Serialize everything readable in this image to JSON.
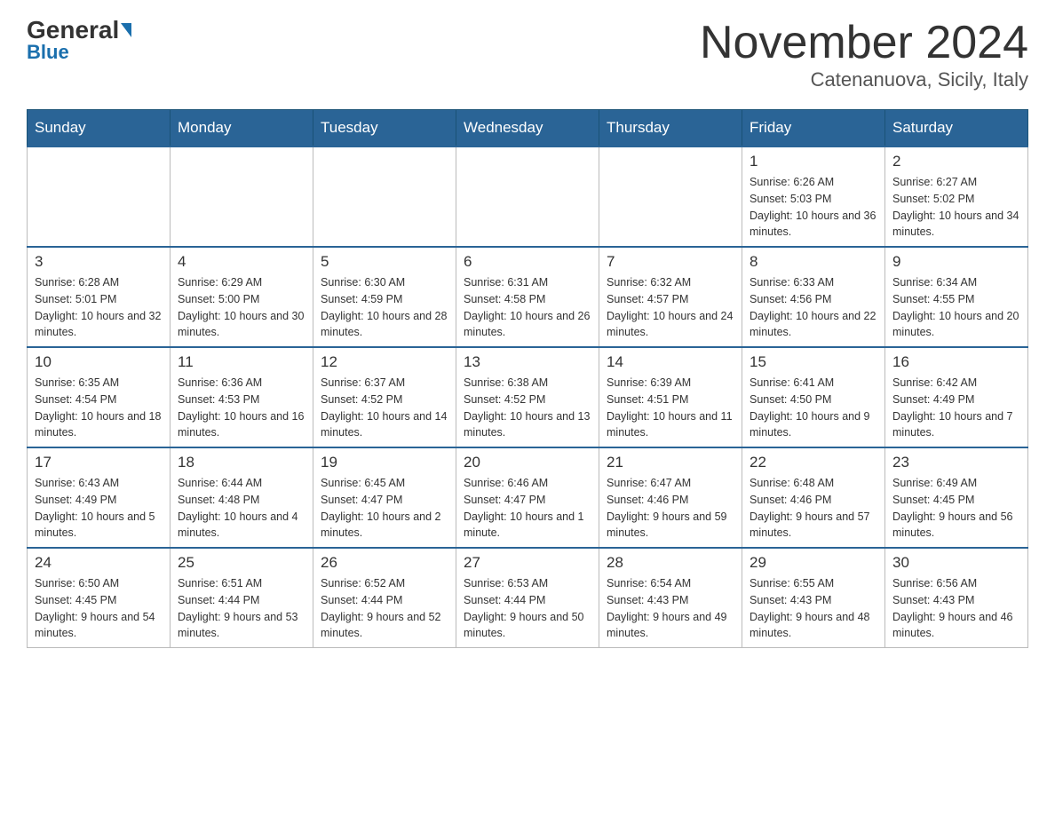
{
  "header": {
    "logo_general": "General",
    "logo_blue": "Blue",
    "month_title": "November 2024",
    "location": "Catenanuova, Sicily, Italy"
  },
  "weekdays": [
    "Sunday",
    "Monday",
    "Tuesday",
    "Wednesday",
    "Thursday",
    "Friday",
    "Saturday"
  ],
  "weeks": [
    [
      {
        "day": "",
        "info": ""
      },
      {
        "day": "",
        "info": ""
      },
      {
        "day": "",
        "info": ""
      },
      {
        "day": "",
        "info": ""
      },
      {
        "day": "",
        "info": ""
      },
      {
        "day": "1",
        "info": "Sunrise: 6:26 AM\nSunset: 5:03 PM\nDaylight: 10 hours and 36 minutes."
      },
      {
        "day": "2",
        "info": "Sunrise: 6:27 AM\nSunset: 5:02 PM\nDaylight: 10 hours and 34 minutes."
      }
    ],
    [
      {
        "day": "3",
        "info": "Sunrise: 6:28 AM\nSunset: 5:01 PM\nDaylight: 10 hours and 32 minutes."
      },
      {
        "day": "4",
        "info": "Sunrise: 6:29 AM\nSunset: 5:00 PM\nDaylight: 10 hours and 30 minutes."
      },
      {
        "day": "5",
        "info": "Sunrise: 6:30 AM\nSunset: 4:59 PM\nDaylight: 10 hours and 28 minutes."
      },
      {
        "day": "6",
        "info": "Sunrise: 6:31 AM\nSunset: 4:58 PM\nDaylight: 10 hours and 26 minutes."
      },
      {
        "day": "7",
        "info": "Sunrise: 6:32 AM\nSunset: 4:57 PM\nDaylight: 10 hours and 24 minutes."
      },
      {
        "day": "8",
        "info": "Sunrise: 6:33 AM\nSunset: 4:56 PM\nDaylight: 10 hours and 22 minutes."
      },
      {
        "day": "9",
        "info": "Sunrise: 6:34 AM\nSunset: 4:55 PM\nDaylight: 10 hours and 20 minutes."
      }
    ],
    [
      {
        "day": "10",
        "info": "Sunrise: 6:35 AM\nSunset: 4:54 PM\nDaylight: 10 hours and 18 minutes."
      },
      {
        "day": "11",
        "info": "Sunrise: 6:36 AM\nSunset: 4:53 PM\nDaylight: 10 hours and 16 minutes."
      },
      {
        "day": "12",
        "info": "Sunrise: 6:37 AM\nSunset: 4:52 PM\nDaylight: 10 hours and 14 minutes."
      },
      {
        "day": "13",
        "info": "Sunrise: 6:38 AM\nSunset: 4:52 PM\nDaylight: 10 hours and 13 minutes."
      },
      {
        "day": "14",
        "info": "Sunrise: 6:39 AM\nSunset: 4:51 PM\nDaylight: 10 hours and 11 minutes."
      },
      {
        "day": "15",
        "info": "Sunrise: 6:41 AM\nSunset: 4:50 PM\nDaylight: 10 hours and 9 minutes."
      },
      {
        "day": "16",
        "info": "Sunrise: 6:42 AM\nSunset: 4:49 PM\nDaylight: 10 hours and 7 minutes."
      }
    ],
    [
      {
        "day": "17",
        "info": "Sunrise: 6:43 AM\nSunset: 4:49 PM\nDaylight: 10 hours and 5 minutes."
      },
      {
        "day": "18",
        "info": "Sunrise: 6:44 AM\nSunset: 4:48 PM\nDaylight: 10 hours and 4 minutes."
      },
      {
        "day": "19",
        "info": "Sunrise: 6:45 AM\nSunset: 4:47 PM\nDaylight: 10 hours and 2 minutes."
      },
      {
        "day": "20",
        "info": "Sunrise: 6:46 AM\nSunset: 4:47 PM\nDaylight: 10 hours and 1 minute."
      },
      {
        "day": "21",
        "info": "Sunrise: 6:47 AM\nSunset: 4:46 PM\nDaylight: 9 hours and 59 minutes."
      },
      {
        "day": "22",
        "info": "Sunrise: 6:48 AM\nSunset: 4:46 PM\nDaylight: 9 hours and 57 minutes."
      },
      {
        "day": "23",
        "info": "Sunrise: 6:49 AM\nSunset: 4:45 PM\nDaylight: 9 hours and 56 minutes."
      }
    ],
    [
      {
        "day": "24",
        "info": "Sunrise: 6:50 AM\nSunset: 4:45 PM\nDaylight: 9 hours and 54 minutes."
      },
      {
        "day": "25",
        "info": "Sunrise: 6:51 AM\nSunset: 4:44 PM\nDaylight: 9 hours and 53 minutes."
      },
      {
        "day": "26",
        "info": "Sunrise: 6:52 AM\nSunset: 4:44 PM\nDaylight: 9 hours and 52 minutes."
      },
      {
        "day": "27",
        "info": "Sunrise: 6:53 AM\nSunset: 4:44 PM\nDaylight: 9 hours and 50 minutes."
      },
      {
        "day": "28",
        "info": "Sunrise: 6:54 AM\nSunset: 4:43 PM\nDaylight: 9 hours and 49 minutes."
      },
      {
        "day": "29",
        "info": "Sunrise: 6:55 AM\nSunset: 4:43 PM\nDaylight: 9 hours and 48 minutes."
      },
      {
        "day": "30",
        "info": "Sunrise: 6:56 AM\nSunset: 4:43 PM\nDaylight: 9 hours and 46 minutes."
      }
    ]
  ]
}
